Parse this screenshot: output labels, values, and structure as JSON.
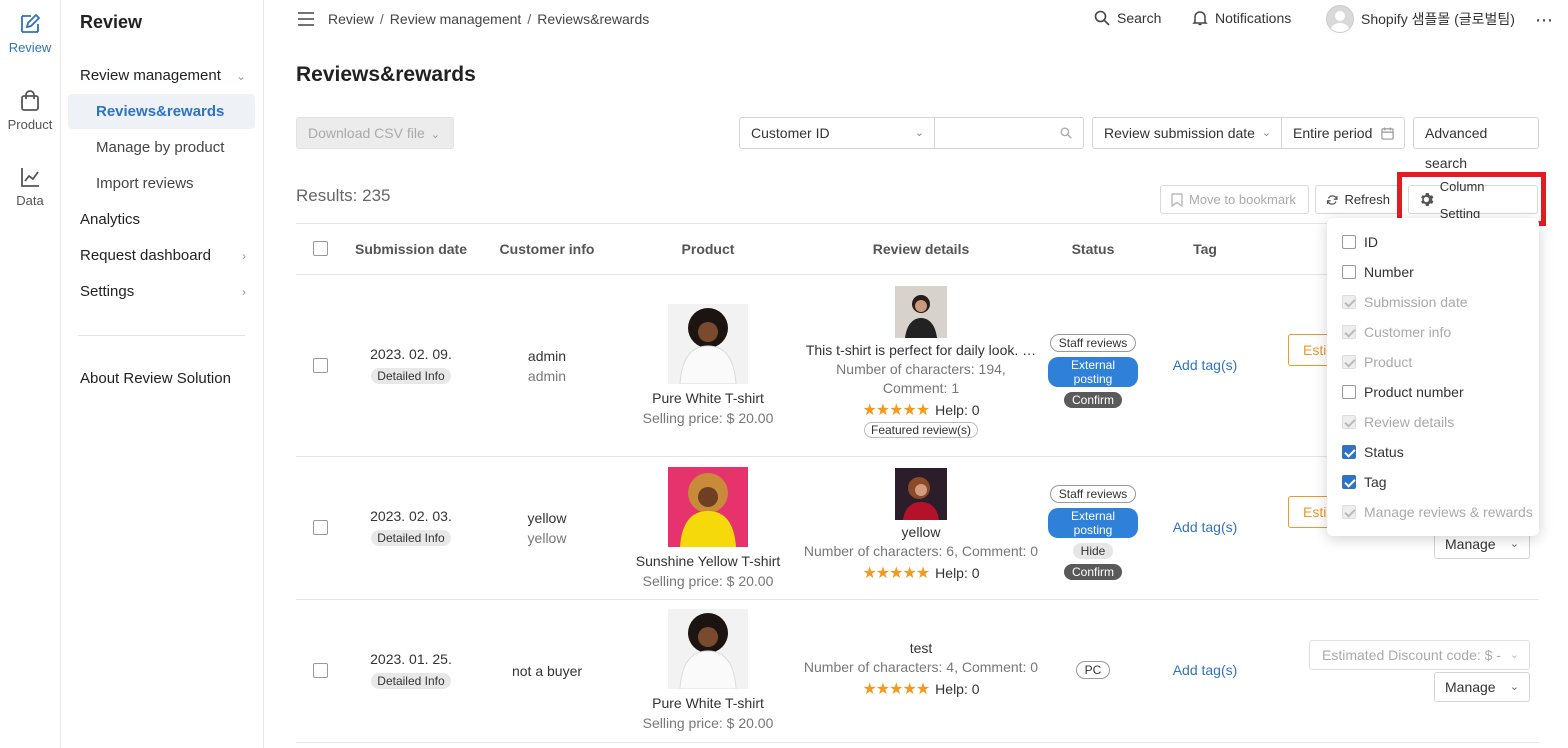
{
  "rail": {
    "items": [
      {
        "label": "Review",
        "icon": "edit-icon",
        "active": true
      },
      {
        "label": "Product",
        "icon": "shopping-bag-icon",
        "active": false
      },
      {
        "label": "Data",
        "icon": "chart-icon",
        "active": false
      }
    ]
  },
  "sidenav": {
    "title": "Review",
    "review_management": "Review management",
    "sub_items": [
      "Reviews&rewards",
      "Manage by product",
      "Import reviews"
    ],
    "analytics": "Analytics",
    "request_dashboard": "Request dashboard",
    "settings": "Settings",
    "about": "About Review Solution"
  },
  "topbar": {
    "breadcrumb": [
      "Review",
      "Review management",
      "Reviews&rewards"
    ],
    "search_label": "Search",
    "notifications_label": "Notifications",
    "account_name": "Shopify 샘플몰 (글로벌팀)"
  },
  "page": {
    "title": "Reviews&rewards"
  },
  "toolbar": {
    "download_csv": "Download CSV file",
    "filter_field": "Customer ID",
    "search_value": "",
    "date_type": "Review submission date",
    "period": "Entire period",
    "advanced_search": "Advanced search"
  },
  "results": {
    "label": "Results: 235",
    "move_to_bookmark": "Move to bookmark",
    "refresh": "Refresh",
    "column_setting": "Column Setting"
  },
  "table": {
    "headers": [
      "Submission date",
      "Customer info",
      "Product",
      "Review details",
      "Status",
      "Tag"
    ],
    "rows": [
      {
        "date": "2023. 02. 09.",
        "detail_chip": "Detailed Info",
        "customer_name": "admin",
        "customer_id": "admin",
        "product_name": "Pure White T-shirt",
        "price": "Selling price: $ 20.00",
        "review_text": "This t-shirt is perfect for daily look. …",
        "review_meta_1": "Number of characters: 194,",
        "review_meta_2": "Comment: 1",
        "help": "Help: 0",
        "featured": "Featured review(s)",
        "statuses": [
          "Staff reviews",
          "External posting",
          "Confirm"
        ],
        "tag_link": "Add tag(s)",
        "action": "Esti"
      },
      {
        "date": "2023. 02. 03.",
        "detail_chip": "Detailed Info",
        "customer_name": "yellow",
        "customer_id": "yellow",
        "product_name": "Sunshine Yellow T-shirt",
        "price": "Selling price: $ 20.00",
        "review_text": "yellow",
        "review_meta_1": "Number of characters: 6, Comment: 0",
        "help": "Help: 0",
        "statuses": [
          "Staff reviews",
          "External posting",
          "Hide",
          "Confirm"
        ],
        "tag_link": "Add tag(s)",
        "action": "Esti",
        "manage": "Manage"
      },
      {
        "date": "2023. 01. 25.",
        "detail_chip": "Detailed Info",
        "customer_name": "not a buyer",
        "product_name": "Pure White T-shirt",
        "price": "Selling price: $ 20.00",
        "review_text": "test",
        "review_meta_1": "Number of characters: 4, Comment: 0",
        "help": "Help: 0",
        "statuses": [
          "PC"
        ],
        "tag_link": "Add tag(s)",
        "discount_select": "Estimated Discount code: $ -",
        "manage": "Manage"
      }
    ]
  },
  "column_settings": {
    "options": [
      {
        "label": "ID",
        "state": "unchecked"
      },
      {
        "label": "Number",
        "state": "unchecked"
      },
      {
        "label": "Submission date",
        "state": "locked"
      },
      {
        "label": "Customer info",
        "state": "locked"
      },
      {
        "label": "Product",
        "state": "locked"
      },
      {
        "label": "Product number",
        "state": "unchecked"
      },
      {
        "label": "Review details",
        "state": "locked"
      },
      {
        "label": "Status",
        "state": "checked"
      },
      {
        "label": "Tag",
        "state": "checked"
      },
      {
        "label": "Manage reviews & rewards",
        "state": "locked"
      }
    ]
  },
  "colors": {
    "accent": "#2f73c4",
    "badge_blue": "#2f80d8",
    "orange": "#f0962c",
    "star": "#f39a1d",
    "highlight": "#e31b23"
  }
}
